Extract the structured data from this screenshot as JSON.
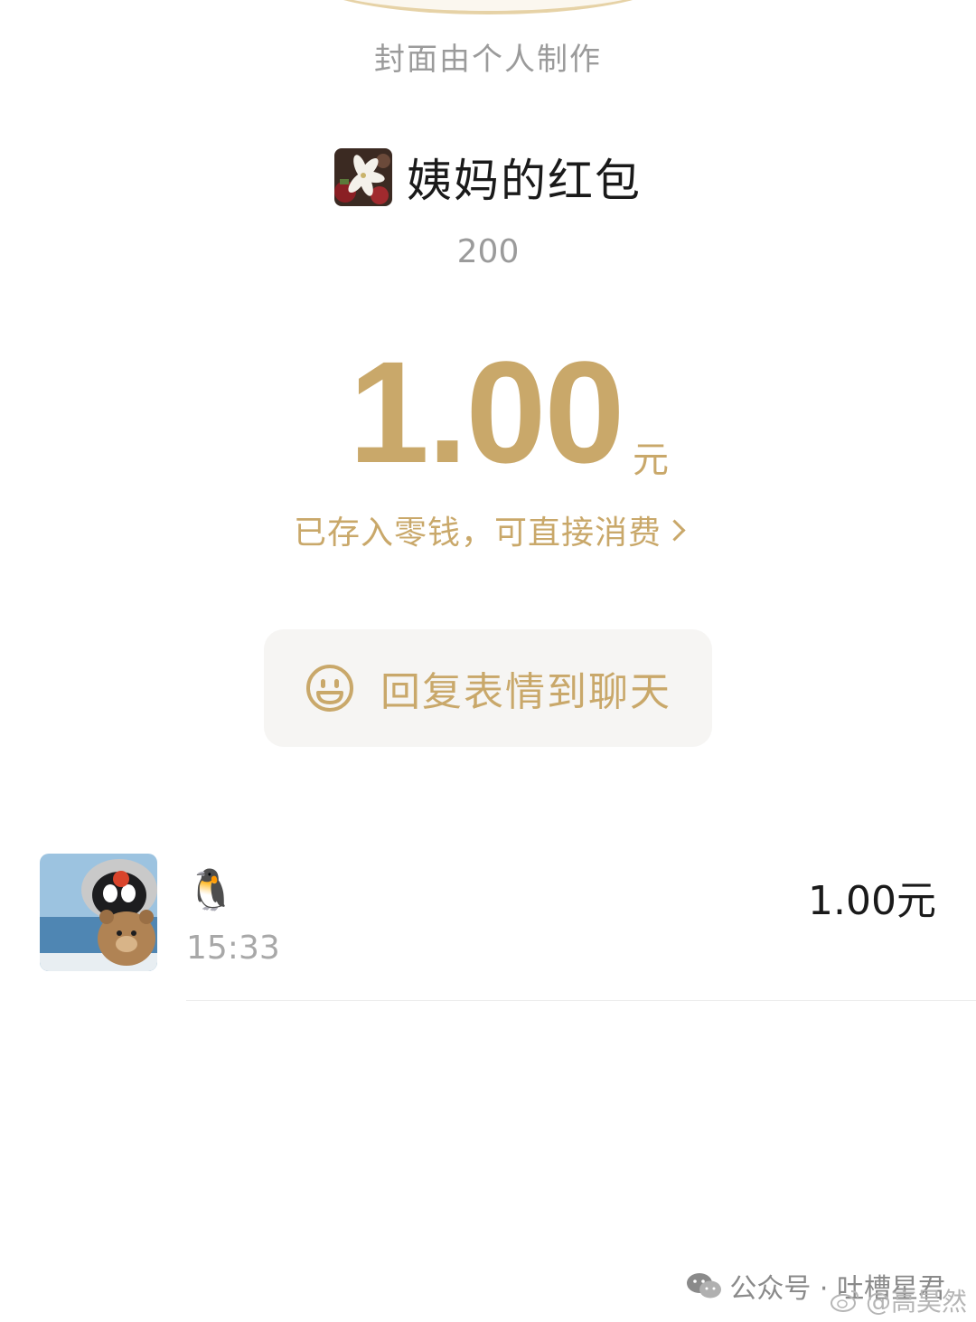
{
  "cover": {
    "note": "封面由个人制作"
  },
  "sender": {
    "name": "姨妈的红包",
    "avatar_icon": "lily-flower-photo"
  },
  "remark": "200",
  "amount": {
    "value": "1.00",
    "unit": "元"
  },
  "wallet_note": "已存入零钱，可直接消费",
  "reply_button": {
    "label": "回复表情到聊天",
    "icon": "smiley-icon"
  },
  "receivers": [
    {
      "name": "🐧",
      "time": "15:33",
      "amount": "1.00元",
      "avatar_icon": "plush-penguin-photo"
    }
  ],
  "watermarks": {
    "wechat": "公众号 · 吐槽星君",
    "weibo": "@高昊然"
  },
  "colors": {
    "accent": "#c9a86a",
    "gray_text": "#9b9b9b",
    "button_bg": "#f6f5f3"
  }
}
